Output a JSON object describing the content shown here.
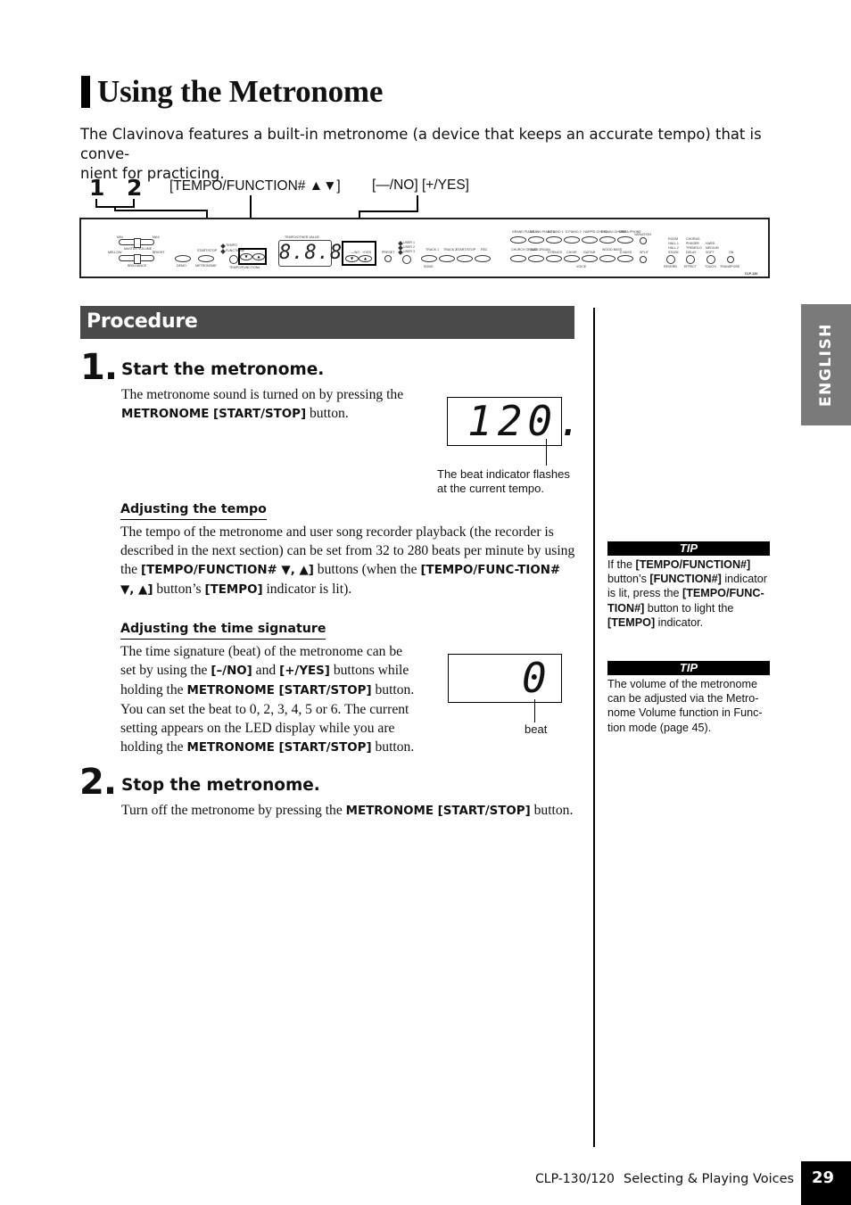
{
  "title": "Using the Metronome",
  "intro": "The Clavinova features a built-in metronome (a device that keeps an accurate tempo) that is conve-nient for practicing.",
  "intro_line1": "The Clavinova features a built-in metronome (a device that keeps an accurate tempo) that is conve-",
  "intro_line2": "nient for practicing.",
  "callouts": {
    "num1": "1",
    "num2": "2",
    "tempo_function": "[TEMPO/FUNCTION# ▲▼]",
    "no_yes": "[—/NO] [+/YES]"
  },
  "panel": {
    "model": "CLP-130",
    "display": "8.8.8.",
    "labels": {
      "min": "MIN",
      "max": "MAX",
      "master_volume": "MASTER VOLUME",
      "mellow": "MELLOW",
      "bright": "BRIGHT",
      "brilliance": "BRILLIANCE",
      "demo": "DEMO",
      "start_stop": "START/STOP",
      "metronome": "METRONOME",
      "tempo": "TEMPO",
      "function": "FUNCTION#",
      "tempo_function": "TEMPO/FUNCTION#",
      "tempo_other_value": "TEMPO/OTHER VALUE",
      "no": "—/NO",
      "yes": "+/YES",
      "preset": "PRESET",
      "user1": "USER 1",
      "user2": "USER 2",
      "user3": "USER 3",
      "track1": "TRACK 1",
      "track2": "TRACK 2",
      "song_start_stop": "START/STOP",
      "rec": "REC",
      "song": "SONG",
      "voice": "VOICE",
      "variation": "VARIATION",
      "split": "SPLIT",
      "reverb": "REVERB",
      "effect": "EFFECT",
      "touch": "TOUCH",
      "transpose": "TRANSPOSE",
      "on": "ON"
    },
    "voices_top": [
      "GRAND PIANO 1",
      "GRAND PIANO 2",
      "E.PIANO 1",
      "E.PIANO 2",
      "HARPSI-CHORD",
      "E.CLAVI-CHORD",
      "VIBRA-PHONE"
    ],
    "voices_bottom": [
      "CHURCH ORGAN",
      "JAZZ ORGAN",
      "STRINGS",
      "CHOIR",
      "GUITAR",
      "WOOD BASS",
      "E.BASS"
    ],
    "reverb_types": [
      "ROOM",
      "HALL 1",
      "HALL 2",
      "STAGE"
    ],
    "effect_types": [
      "CHORUS",
      "PHASER",
      "TREMOLO",
      "DELAY"
    ],
    "touch_types": [
      "HARD",
      "MEDIUM",
      "SOFT"
    ]
  },
  "procedure": {
    "heading": "Procedure",
    "step1": {
      "number": "1.",
      "heading": "Start the metronome.",
      "text_a": "The metronome sound is turned on by pressing the ",
      "text_b": "METRONOME [START/STOP]",
      "text_c": " button.",
      "display_value": "120.",
      "display_caption": "The beat indicator flashes at the current tempo."
    },
    "tempo": {
      "heading": "Adjusting the tempo",
      "t1": "The tempo of the metronome and user song recorder playback (the recorder is described in the next section) can be set from 32 to 280 beats per minute by using the ",
      "b1": "[TEMPO/FUNCTION# ▼, ▲]",
      "t2": " buttons (when the ",
      "b2": "[TEMPO/FUNC-TION# ▼, ▲]",
      "t3": " button’s ",
      "b3": "[TEMPO]",
      "t4": " indicator is lit)."
    },
    "time_signature": {
      "heading": "Adjusting the time signature",
      "t1": "The time signature (beat) of the metronome can be set by using the ",
      "b1": "[–/NO]",
      "t2": " and ",
      "b2": "[+/YES]",
      "t3": " buttons while holding the ",
      "b3": "METRONOME [START/STOP]",
      "t4": " button. You can set the beat to 0, 2, 3, 4, 5 or 6. The current setting appears on the LED display while you are holding the ",
      "b4": "METRONOME [START/STOP]",
      "t5": " button.",
      "display_value": "0",
      "display_caption": "beat"
    },
    "step2": {
      "number": "2.",
      "heading": "Stop the metronome.",
      "text_a": "Turn off the metronome by pressing the ",
      "text_b": "METRONOME [START/STOP]",
      "text_c": " button."
    }
  },
  "tips": [
    {
      "label": "TIP",
      "t1": "If the ",
      "b1": "[TEMPO/FUNCTION#]",
      "t2": " button’s ",
      "b2": "[FUNCTION#]",
      "t3": " indicator is lit, press the ",
      "b3": "[TEMPO/FUNC-TION#]",
      "t4": " button to light the ",
      "b4": "[TEMPO]",
      "t5": " indicator."
    },
    {
      "label": "TIP",
      "text": "The volume of the metronome can be adjusted via the Metro-nome Volume function in Func-tion mode (page 45)."
    }
  ],
  "side_tab": "ENGLISH",
  "footer": {
    "model": "CLP-130/120",
    "section": "Selecting & Playing Voices",
    "page": "29"
  }
}
